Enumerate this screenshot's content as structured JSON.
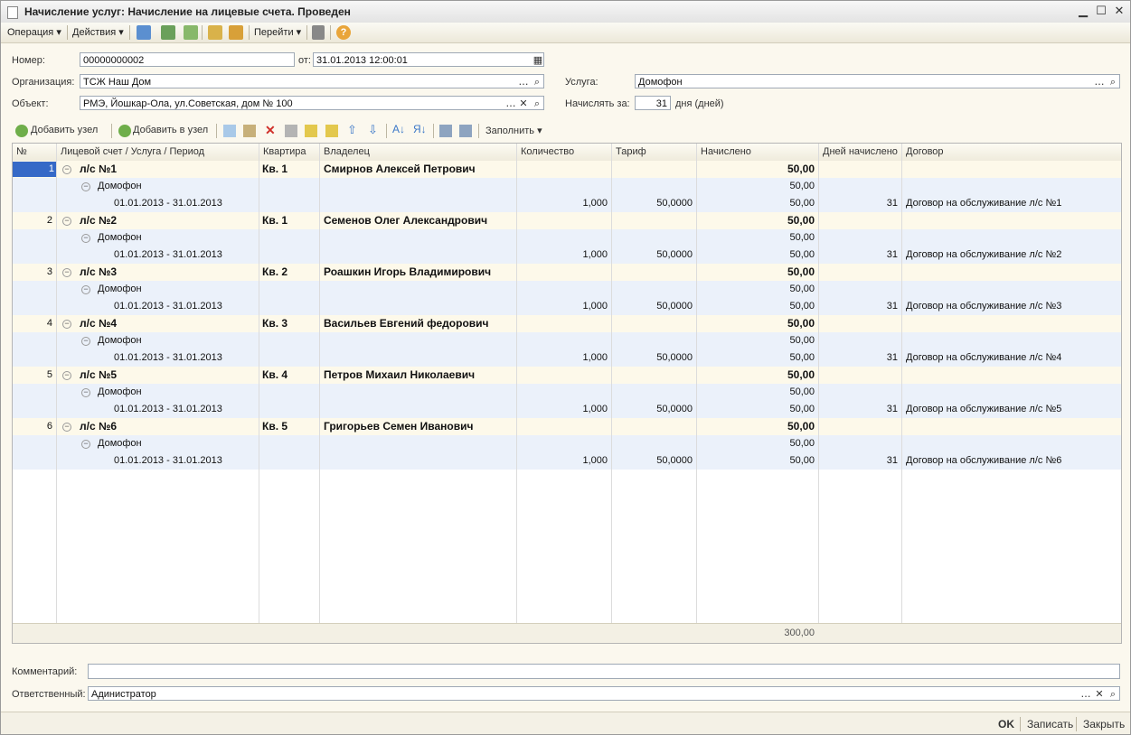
{
  "window": {
    "title": "Начисление услуг: Начисление на лицевые счета. Проведен"
  },
  "menu": {
    "operation": "Операция",
    "actions": "Действия",
    "goto": "Перейти"
  },
  "form": {
    "number_label": "Номер:",
    "number": "00000000002",
    "date_label": "от:",
    "date": "31.01.2013 12:00:01",
    "org_label": "Организация:",
    "org": "ТСЖ Наш Дом",
    "object_label": "Объект:",
    "object": "РМЭ, Йошкар-Ола, ул.Советская, дом № 100",
    "service_label": "Услуга:",
    "service": "Домофон",
    "charge_for_label": "Начислять за:",
    "charge_for_days": "31",
    "days_suffix": "дня (дней)"
  },
  "table_toolbar": {
    "add_node": "Добавить узел",
    "add_to_node": "Добавить в узел",
    "fill": "Заполнить"
  },
  "columns": [
    "№",
    "Лицевой счет / Услуга / Период",
    "Квартира",
    "Владелец",
    "Количество",
    "Тариф",
    "Начислено",
    "Дней начислено",
    "Договор"
  ],
  "rows": [
    {
      "no": "1",
      "account": "л/с №1",
      "apt": "Кв. 1",
      "owner": "Смирнов Алексей Петрович",
      "total": "50,00",
      "service": "Домофон",
      "svc_total": "50,00",
      "period": "01.01.2013 - 31.01.2013",
      "qty": "1,000",
      "tariff": "50,0000",
      "charged": "50,00",
      "days": "31",
      "contract": "Договор на обслуживание л/с №1"
    },
    {
      "no": "2",
      "account": "л/с №2",
      "apt": "Кв. 1",
      "owner": "Семенов Олег Александрович",
      "total": "50,00",
      "service": "Домофон",
      "svc_total": "50,00",
      "period": "01.01.2013 - 31.01.2013",
      "qty": "1,000",
      "tariff": "50,0000",
      "charged": "50,00",
      "days": "31",
      "contract": "Договор на обслуживание л/с №2"
    },
    {
      "no": "3",
      "account": "л/с №3",
      "apt": "Кв. 2",
      "owner": "Роашкин Игорь Владимирович",
      "total": "50,00",
      "service": "Домофон",
      "svc_total": "50,00",
      "period": "01.01.2013 - 31.01.2013",
      "qty": "1,000",
      "tariff": "50,0000",
      "charged": "50,00",
      "days": "31",
      "contract": "Договор на обслуживание л/с №3"
    },
    {
      "no": "4",
      "account": "л/с №4",
      "apt": "Кв. 3",
      "owner": "Васильев Евгений федорович",
      "total": "50,00",
      "service": "Домофон",
      "svc_total": "50,00",
      "period": "01.01.2013 - 31.01.2013",
      "qty": "1,000",
      "tariff": "50,0000",
      "charged": "50,00",
      "days": "31",
      "contract": "Договор на обслуживание л/с №4"
    },
    {
      "no": "5",
      "account": "л/с №5",
      "apt": "Кв. 4",
      "owner": "Петров Михаил Николаевич",
      "total": "50,00",
      "service": "Домофон",
      "svc_total": "50,00",
      "period": "01.01.2013 - 31.01.2013",
      "qty": "1,000",
      "tariff": "50,0000",
      "charged": "50,00",
      "days": "31",
      "contract": "Договор на обслуживание л/с №5"
    },
    {
      "no": "6",
      "account": "л/с №6",
      "apt": "Кв. 5",
      "owner": "Григорьев Семен Иванович",
      "total": "50,00",
      "service": "Домофон",
      "svc_total": "50,00",
      "period": "01.01.2013 - 31.01.2013",
      "qty": "1,000",
      "tariff": "50,0000",
      "charged": "50,00",
      "days": "31",
      "contract": "Договор на обслуживание л/с №6"
    }
  ],
  "footer_total": "300,00",
  "comment_label": "Комментарий:",
  "comment": "",
  "responsible_label": "Ответственный:",
  "responsible": "Адинистратор",
  "buttons": {
    "ok": "OK",
    "save": "Записать",
    "close": "Закрыть"
  },
  "colors": {
    "row_bg": "#fdf9ea",
    "sub_bg": "#ebf1fa",
    "selected": "#3569c7",
    "accent": "#3c78c8"
  }
}
